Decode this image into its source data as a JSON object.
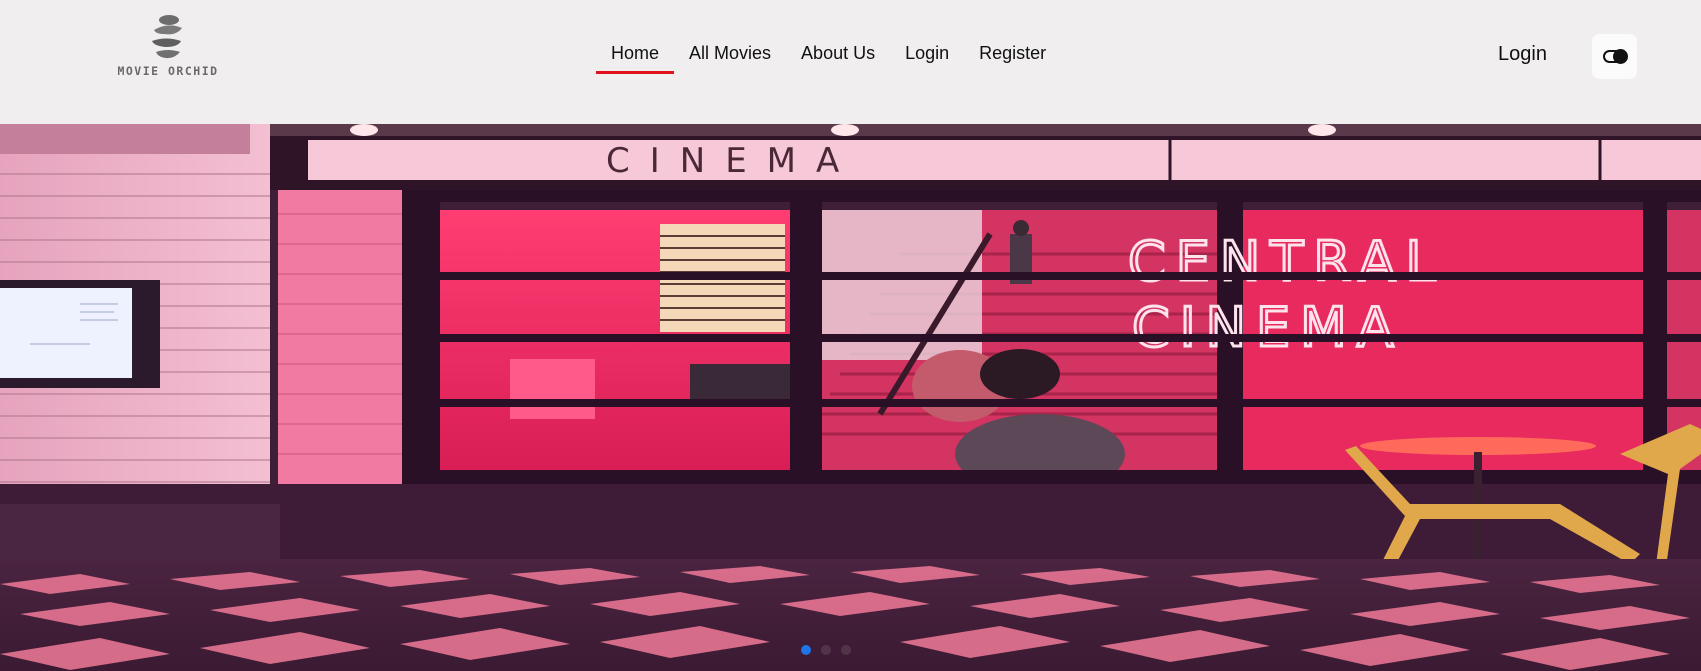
{
  "brand": {
    "logo_text": "MOVIE ORCHID",
    "logo_icon": "orchid-stone-stack-icon"
  },
  "nav": {
    "items": [
      {
        "label": "Home",
        "active": true
      },
      {
        "label": "All Movies",
        "active": false
      },
      {
        "label": "About Us",
        "active": false
      },
      {
        "label": "Login",
        "active": false
      },
      {
        "label": "Register",
        "active": false
      }
    ]
  },
  "header": {
    "login_label": "Login",
    "theme_toggle_icon": "toggle-switch-icon"
  },
  "hero": {
    "sign_text": "CINEMA",
    "neon_line_1": "CENTRAL",
    "neon_line_2": "CINEMA",
    "slide_count": 3,
    "active_slide": 1
  },
  "colors": {
    "accent": "#e0131c",
    "header_bg": "#f0eeee",
    "dot_active": "#1e74e8",
    "neon": "#ff3d6e"
  }
}
